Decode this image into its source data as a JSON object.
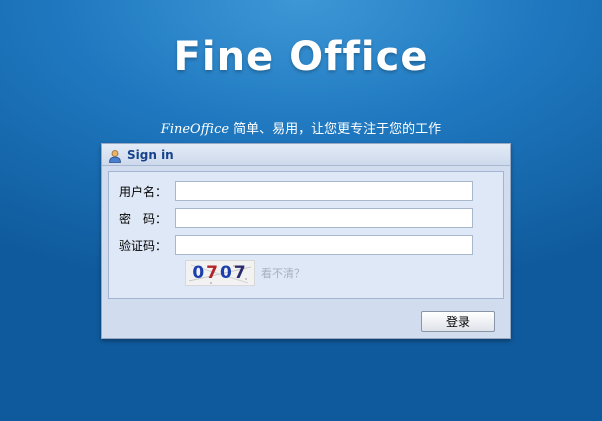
{
  "header": {
    "logo_text": "Fine Office",
    "slogan_brand": "FineOffice",
    "slogan_text": " 简单、易用，让您更专注于您的工作"
  },
  "panel": {
    "title": "Sign in",
    "username_label": "用户名：",
    "username_value": "",
    "password_label": "密　码：",
    "password_value": "",
    "captcha_label": "验证码：",
    "captcha_value": "",
    "captcha_digits": [
      "0",
      "7",
      "0",
      "7"
    ],
    "refresh_text": "看不清？",
    "login_button": "登录"
  },
  "icons": {
    "panel_icon": "user-icon"
  },
  "colors": {
    "background": "#1f78bf",
    "panel_bg": "#d1ddef",
    "title_color": "#15428b"
  }
}
